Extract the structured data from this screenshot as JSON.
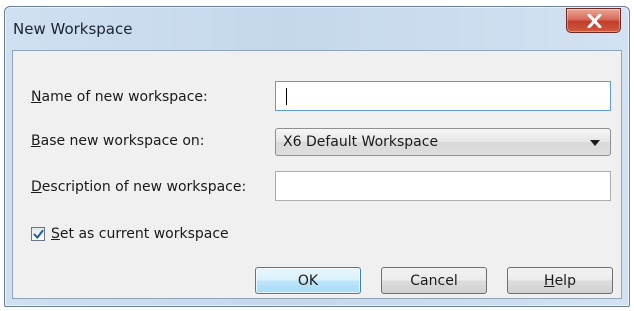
{
  "window": {
    "title": "New Workspace",
    "close_icon": "close-x-icon"
  },
  "form": {
    "name": {
      "label_access_key": "N",
      "label_rest": "ame of new workspace:",
      "value": ""
    },
    "base": {
      "label_access_key": "B",
      "label_rest": "ase new workspace on:",
      "selected": "X6 Default Workspace",
      "icon": "chevron-down-icon"
    },
    "description": {
      "label_access_key": "D",
      "label_rest": "escription of new workspace:",
      "value": ""
    },
    "set_current": {
      "checked": true,
      "label_access_key": "S",
      "label_rest": "et as current workspace",
      "icon": "checkmark-icon"
    }
  },
  "buttons": {
    "ok": "OK",
    "cancel": "Cancel",
    "help_access_key": "H",
    "help_rest": "elp"
  },
  "colors": {
    "title_bar": "#c5d7eb",
    "close_button": "#c94a36",
    "dialog_body": "#f0f0f0",
    "default_button": "#bee6fd",
    "focus_border": "#5f9bd4",
    "checkmark": "#1f5ea8"
  }
}
